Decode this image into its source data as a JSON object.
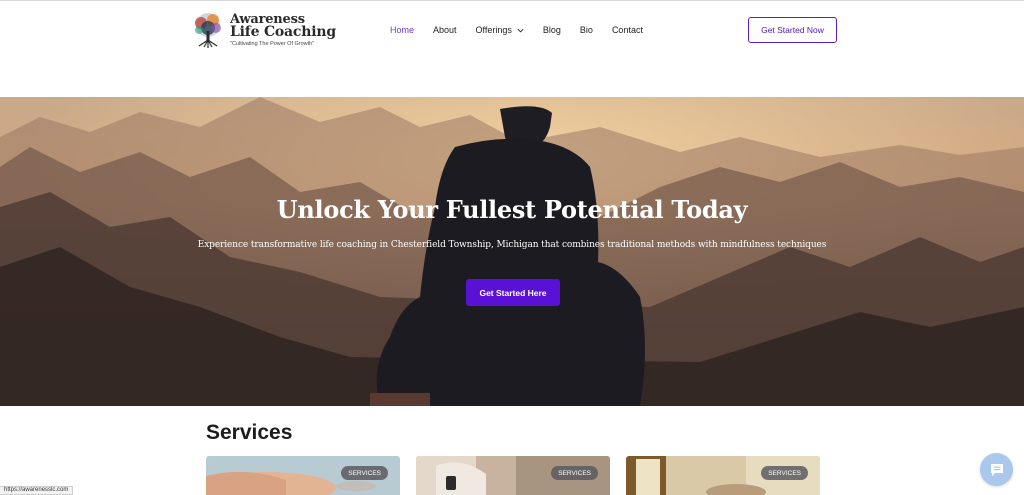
{
  "brand": {
    "name_line1": "Awareness",
    "name_line2": "Life Coaching",
    "tagline": "\"Cultivating The Power Of Growth\""
  },
  "nav": {
    "items": [
      {
        "label": "Home",
        "active": true
      },
      {
        "label": "About",
        "active": false
      },
      {
        "label": "Offerings",
        "active": false,
        "has_dropdown": true
      },
      {
        "label": "Blog",
        "active": false
      },
      {
        "label": "Bio",
        "active": false
      },
      {
        "label": "Contact",
        "active": false
      }
    ],
    "cta_label": "Get Started Now"
  },
  "hero": {
    "title": "Unlock Your Fullest Potential Today",
    "subtitle": "Experience transformative life coaching in Chesterfield Township, Michigan that combines traditional methods with mindfulness techniques",
    "button_label": "Get Started Here"
  },
  "services": {
    "title": "Services",
    "cards": [
      {
        "badge": "SERVICES"
      },
      {
        "badge": "SERVICES"
      },
      {
        "badge": "SERVICES"
      }
    ]
  },
  "status_bar": {
    "url": "https://awarenesslc.com"
  },
  "icons": {
    "logo": "tree-logo-icon",
    "dropdown": "chevron-down-icon",
    "chat": "chat-bubble-icon"
  },
  "colors": {
    "accent": "#5a11d6",
    "nav_active": "#6a3fd9",
    "chat_bg": "#a9c8ec"
  }
}
